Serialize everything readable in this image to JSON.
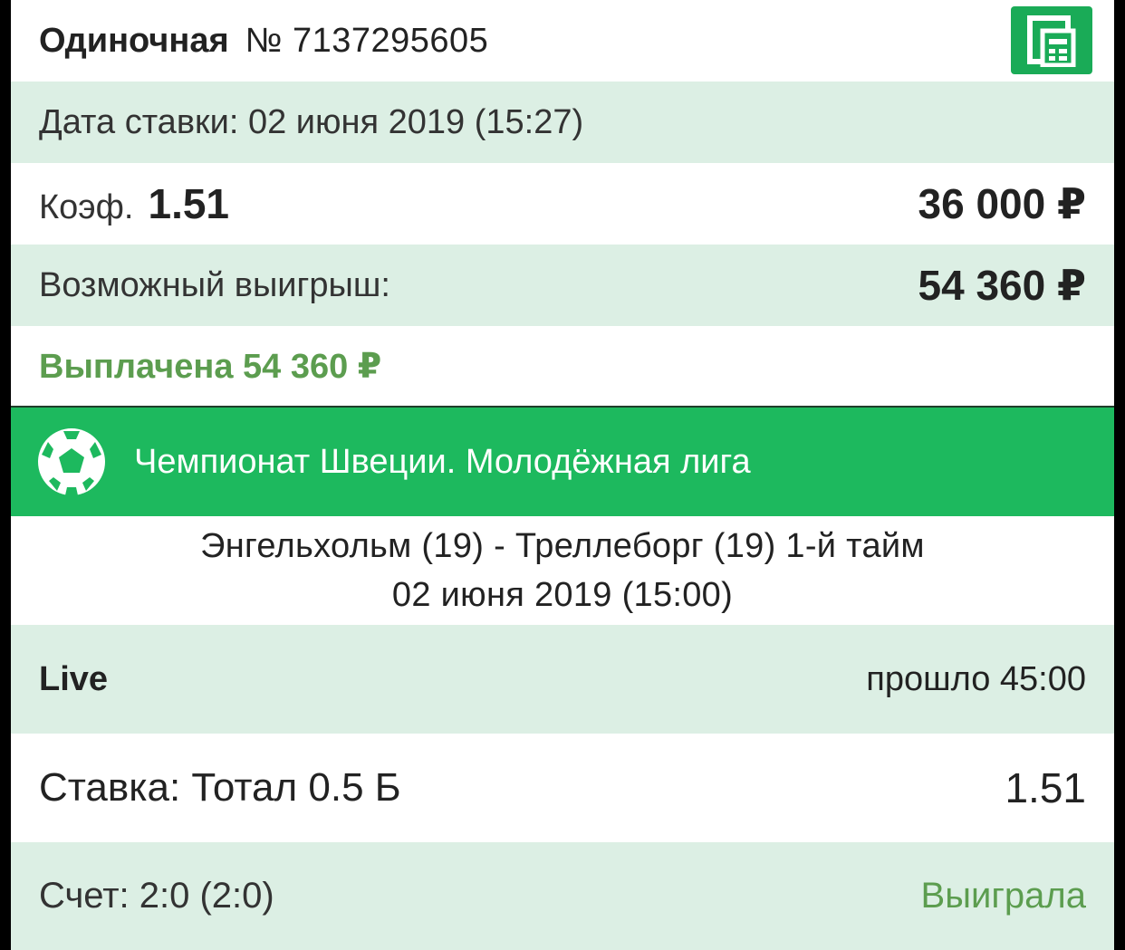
{
  "header": {
    "bet_type": "Одиночная",
    "bet_number": "№ 7137295605",
    "receipt_icon": "receipt-icon"
  },
  "bet": {
    "date_text": "Дата ставки: 02 июня 2019 (15:27)",
    "coef_label": "Коэф.",
    "coef_value": "1.51",
    "stake_amount": "36 000 ₽",
    "possible_win_label": "Возможный выигрыш:",
    "possible_win_amount": "54 360 ₽",
    "paid_text": "Выплачена 54 360 ₽"
  },
  "event": {
    "sport_icon": "soccer-ball-icon",
    "league": "Чемпионат Швеции. Молодёжная лига",
    "teams": "Энгельхольм (19) - Треллеборг (19) 1-й тайм",
    "date": "02 июня 2019 (15:00)",
    "mode": "Live",
    "elapsed": "прошло 45:00",
    "selection": "Ставка: Тотал 0.5 Б",
    "selection_odd": "1.51",
    "score": "Счет: 2:0 (2:0)",
    "result": "Выиграла"
  },
  "colors": {
    "accent_green": "#1db95e",
    "light_green_row": "#dcefe4",
    "won_green": "#5c9d4f"
  }
}
